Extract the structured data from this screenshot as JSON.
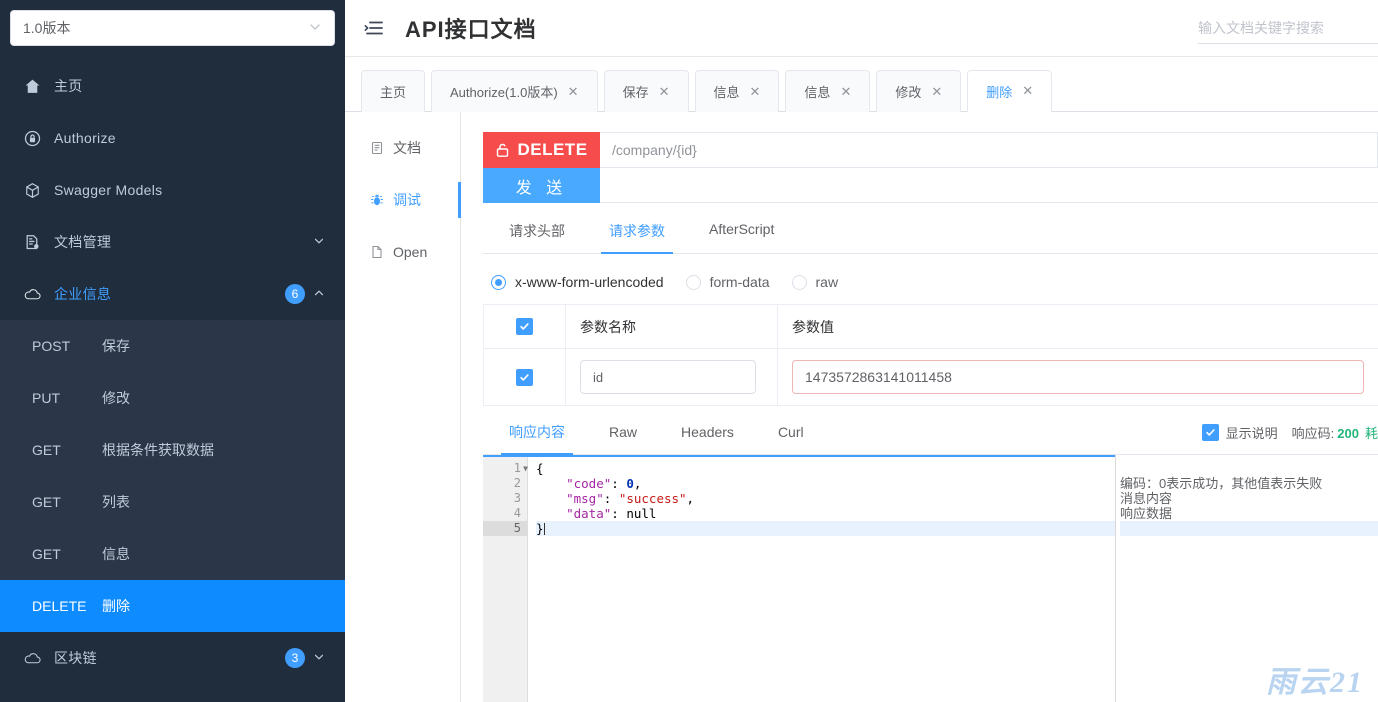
{
  "sidebar": {
    "version": {
      "label": "1.0版本",
      "chevron": "chevron-down-icon"
    },
    "items": [
      {
        "label": "主页",
        "icon": "home-icon"
      },
      {
        "label": "Authorize",
        "icon": "lock-icon"
      },
      {
        "label": "Swagger Models",
        "icon": "cube-icon"
      },
      {
        "label": "文档管理",
        "icon": "document-gear-icon",
        "arrow": "chevron-down-icon"
      },
      {
        "label": "企业信息",
        "icon": "cloud-icon",
        "badge": "6",
        "arrow": "chevron-up-icon",
        "active": true
      }
    ],
    "submenu": [
      {
        "method": "POST",
        "name": "保存"
      },
      {
        "method": "PUT",
        "name": "修改"
      },
      {
        "method": "GET",
        "name": "根据条件获取数据"
      },
      {
        "method": "GET",
        "name": "列表"
      },
      {
        "method": "GET",
        "name": "信息"
      },
      {
        "method": "DELETE",
        "name": "删除",
        "selected": true
      }
    ],
    "bottom_item": {
      "label": "区块链",
      "icon": "cloud-icon",
      "badge": "3",
      "arrow": "chevron-down-icon"
    }
  },
  "topbar": {
    "menu_icon": "collapse-menu-icon",
    "title": "API接口文档",
    "search_placeholder": "输入文档关键字搜索"
  },
  "tabs": [
    {
      "label": "主页",
      "closable": false
    },
    {
      "label": "Authorize(1.0版本)",
      "closable": true
    },
    {
      "label": "保存",
      "closable": true
    },
    {
      "label": "信息",
      "closable": true
    },
    {
      "label": "信息",
      "closable": true
    },
    {
      "label": "修改",
      "closable": true
    },
    {
      "label": "删除",
      "closable": true,
      "active": true
    }
  ],
  "leftnav": [
    {
      "label": "文档",
      "icon": "document-icon"
    },
    {
      "label": "调试",
      "icon": "bug-icon",
      "active": true
    },
    {
      "label": "Open",
      "icon": "file-icon"
    }
  ],
  "request": {
    "method": "DELETE",
    "method_icon": "unlock-icon",
    "url": "/company/{id}",
    "send_label": "发 送",
    "tabs": [
      {
        "label": "请求头部"
      },
      {
        "label": "请求参数",
        "active": true
      },
      {
        "label": "AfterScript"
      }
    ],
    "body_types": [
      {
        "label": "x-www-form-urlencoded",
        "selected": true
      },
      {
        "label": "form-data",
        "selected": false
      },
      {
        "label": "raw",
        "selected": false
      }
    ],
    "table": {
      "headers": {
        "name": "参数名称",
        "value": "参数值"
      },
      "rows": [
        {
          "checked": true,
          "name": "id",
          "value": "1473572863141011458"
        }
      ]
    }
  },
  "response": {
    "tabs": [
      {
        "label": "响应内容",
        "active": true
      },
      {
        "label": "Raw"
      },
      {
        "label": "Headers"
      },
      {
        "label": "Curl"
      }
    ],
    "show_desc_label": "显示说明",
    "show_desc_checked": true,
    "code_label": "响应码:",
    "code_value": "200",
    "code_extra": "耗",
    "editor": {
      "lines": [
        {
          "n": "1",
          "fold": true,
          "tokens": [
            {
              "t": "{",
              "c": "plain"
            }
          ]
        },
        {
          "n": "2",
          "fold": false,
          "tokens": [
            {
              "t": "    ",
              "c": "plain"
            },
            {
              "t": "\"code\"",
              "c": "key"
            },
            {
              "t": ": ",
              "c": "plain"
            },
            {
              "t": "0",
              "c": "num"
            },
            {
              "t": ",",
              "c": "plain"
            }
          ]
        },
        {
          "n": "3",
          "fold": false,
          "tokens": [
            {
              "t": "    ",
              "c": "plain"
            },
            {
              "t": "\"msg\"",
              "c": "key"
            },
            {
              "t": ": ",
              "c": "plain"
            },
            {
              "t": "\"success\"",
              "c": "str"
            },
            {
              "t": ",",
              "c": "plain"
            }
          ]
        },
        {
          "n": "4",
          "fold": false,
          "tokens": [
            {
              "t": "    ",
              "c": "plain"
            },
            {
              "t": "\"data\"",
              "c": "key"
            },
            {
              "t": ": ",
              "c": "plain"
            },
            {
              "t": "null",
              "c": "null"
            }
          ]
        },
        {
          "n": "5",
          "fold": false,
          "current": true,
          "tokens": [
            {
              "t": "}",
              "c": "plain"
            }
          ]
        }
      ],
      "descriptions": [
        "",
        "编码：0表示成功，其他值表示失败",
        "消息内容",
        "响应数据",
        ""
      ]
    },
    "watermark": "雨云21"
  },
  "colors": {
    "accent": "#409eff",
    "sidebar_bg": "#1f2d3d",
    "submenu_bg": "#2b3648",
    "selected_bg": "#0d8bff",
    "delete_red": "#f74c4c",
    "send_blue": "#49a9ff",
    "ok_green": "#21b57a"
  }
}
